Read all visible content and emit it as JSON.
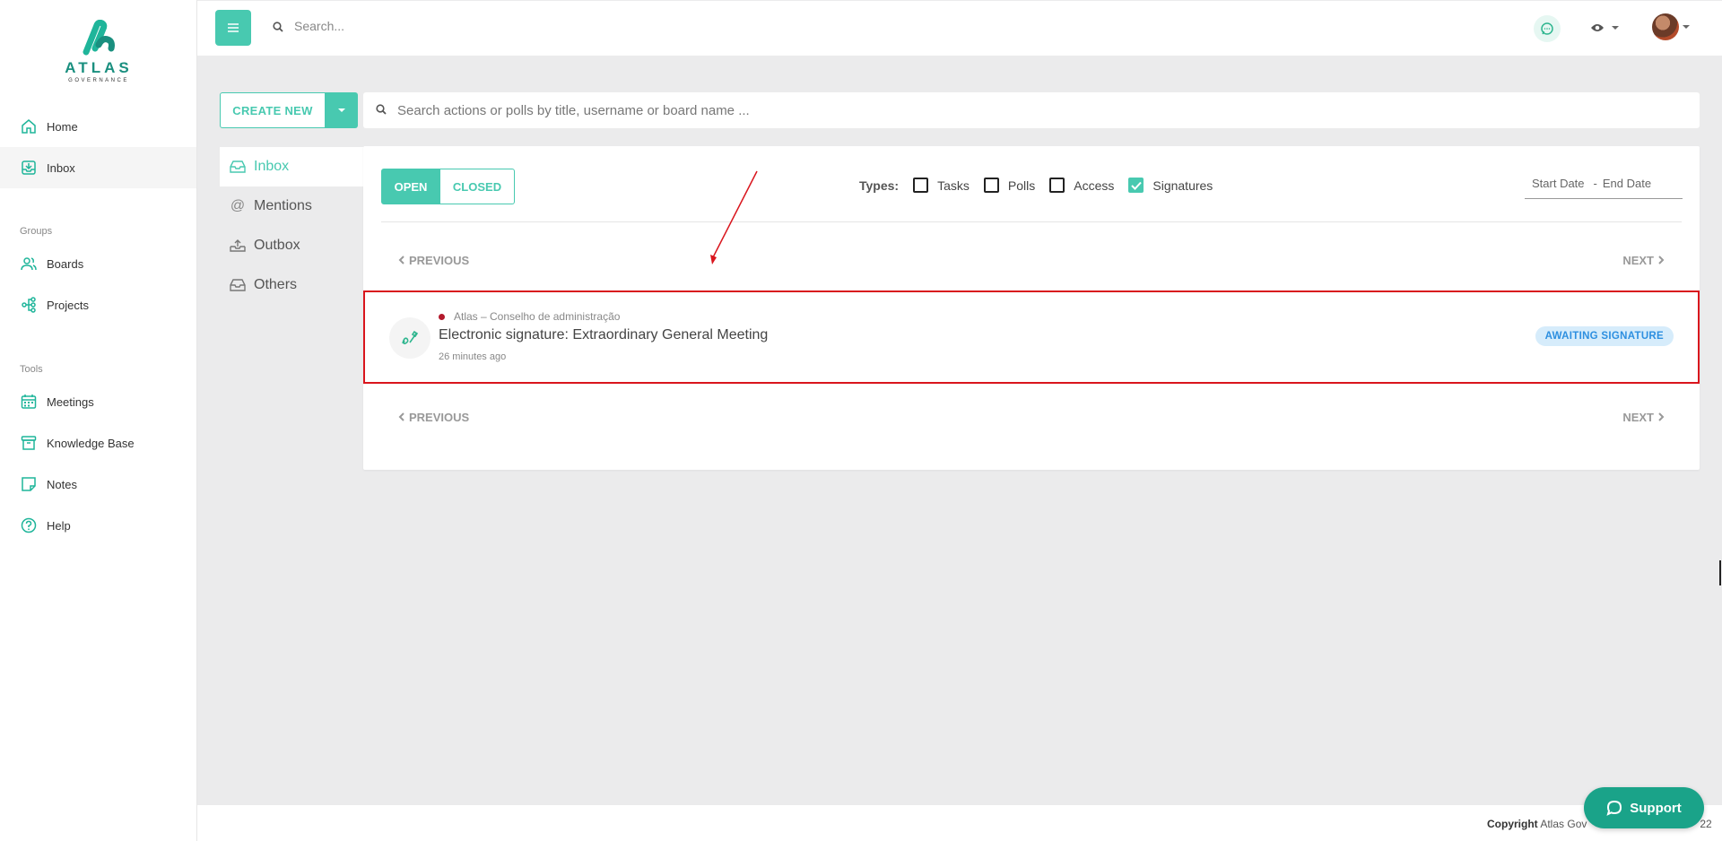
{
  "brand": {
    "name": "ATLAS",
    "sub": "GOVERNANCE"
  },
  "sidebar": {
    "items": [
      {
        "label": "Home",
        "icon": "home-icon"
      },
      {
        "label": "Inbox",
        "icon": "inbox-icon",
        "active": true
      }
    ],
    "groups_label": "Groups",
    "groups": [
      {
        "label": "Boards",
        "icon": "users-icon"
      },
      {
        "label": "Projects",
        "icon": "share-icon"
      }
    ],
    "tools_label": "Tools",
    "tools": [
      {
        "label": "Meetings",
        "icon": "calendar-icon"
      },
      {
        "label": "Knowledge Base",
        "icon": "box-icon"
      },
      {
        "label": "Notes",
        "icon": "note-icon"
      },
      {
        "label": "Help",
        "icon": "help-icon"
      }
    ]
  },
  "topbar": {
    "search_placeholder": "Search..."
  },
  "actions": {
    "create_new": "CREATE NEW",
    "search_placeholder": "Search actions or polls by title, username or board name ..."
  },
  "tabs": [
    {
      "label": "Inbox",
      "icon": "inbox-icon",
      "active": true
    },
    {
      "label": "Mentions",
      "icon": "at-icon"
    },
    {
      "label": "Outbox",
      "icon": "outbox-icon"
    },
    {
      "label": "Others",
      "icon": "tray-icon"
    }
  ],
  "filters": {
    "open": "OPEN",
    "closed": "CLOSED",
    "types_label": "Types:",
    "types": [
      {
        "label": "Tasks",
        "checked": false
      },
      {
        "label": "Polls",
        "checked": false
      },
      {
        "label": "Access",
        "checked": false
      },
      {
        "label": "Signatures",
        "checked": true
      }
    ],
    "start_date": "Start Date",
    "date_sep": "-",
    "end_date": "End Date"
  },
  "pager": {
    "previous": "PREVIOUS",
    "next": "NEXT"
  },
  "item": {
    "board": "Atlas – Conselho de administração",
    "title": "Electronic signature: Extraordinary General Meeting",
    "time": "26 minutes ago",
    "status": "AWAITING SIGNATURE"
  },
  "footer": {
    "copyright_label": "Copyright",
    "copyright_text": "Atlas Gov",
    "copyright_tail": "22"
  },
  "support": {
    "label": "Support"
  },
  "colors": {
    "accent": "#48c9b0",
    "highlight": "#d9151d",
    "badge_bg": "#d6ecfb",
    "badge_text": "#2d8fe0"
  }
}
